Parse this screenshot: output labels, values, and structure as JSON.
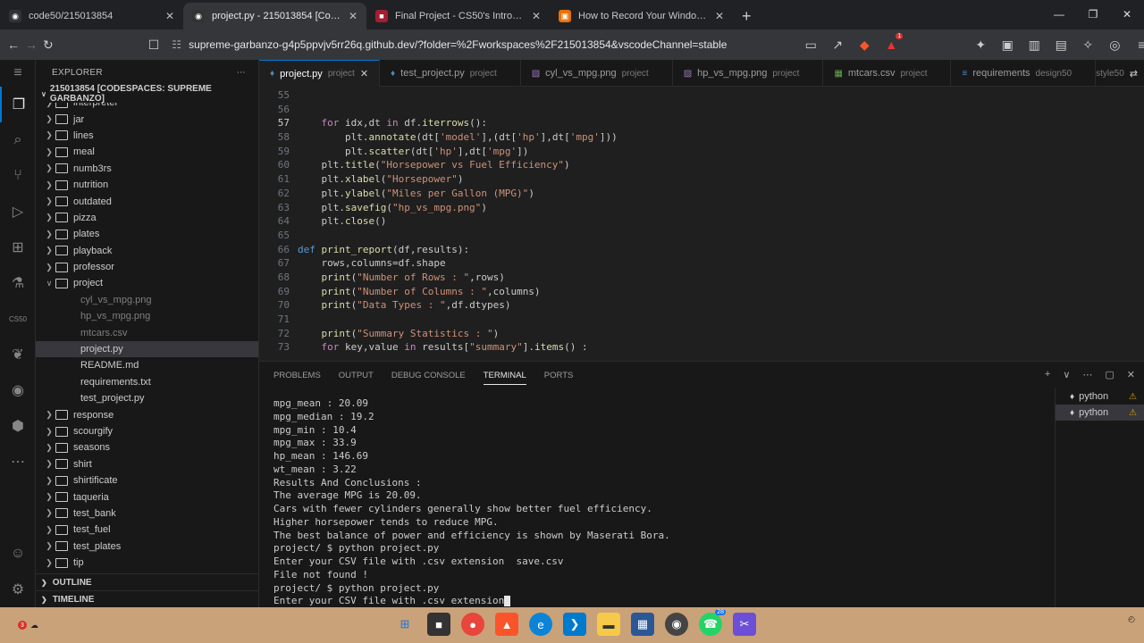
{
  "browser": {
    "tabs": [
      {
        "label": "code50/215013854",
        "icon": "github-icon",
        "active": false
      },
      {
        "label": "project.py - 215013854 [Codespaces",
        "icon": "github-icon",
        "active": true
      },
      {
        "label": "Final Project - CS50's Introduction to",
        "icon": "harvard-icon",
        "active": false
      },
      {
        "label": "How to Record Your Windows, Mac, L",
        "icon": "article-icon",
        "active": false
      }
    ],
    "url": "supreme-garbanzo-g4p5ppvjv5rr26q.github.dev/?folder=%2Fworkspaces%2F215013854&vscodeChannel=stable",
    "badge_count": "1"
  },
  "explorer": {
    "title": "EXPLORER",
    "root": "215013854 [CODESPACES: SUPREME GARBANZO]",
    "items": [
      {
        "label": "interpreter",
        "type": "folder",
        "depth": 0
      },
      {
        "label": "jar",
        "type": "folder",
        "depth": 0
      },
      {
        "label": "lines",
        "type": "folder",
        "depth": 0
      },
      {
        "label": "meal",
        "type": "folder",
        "depth": 0
      },
      {
        "label": "numb3rs",
        "type": "folder",
        "depth": 0
      },
      {
        "label": "nutrition",
        "type": "folder",
        "depth": 0
      },
      {
        "label": "outdated",
        "type": "folder",
        "depth": 0
      },
      {
        "label": "pizza",
        "type": "folder",
        "depth": 0
      },
      {
        "label": "plates",
        "type": "folder",
        "depth": 0
      },
      {
        "label": "playback",
        "type": "folder",
        "depth": 0
      },
      {
        "label": "professor",
        "type": "folder",
        "depth": 0
      },
      {
        "label": "project",
        "type": "folder-open",
        "depth": 0
      },
      {
        "label": "cyl_vs_mpg.png",
        "type": "file-dim",
        "depth": 1
      },
      {
        "label": "hp_vs_mpg.png",
        "type": "file-dim",
        "depth": 1
      },
      {
        "label": "mtcars.csv",
        "type": "file-dim",
        "depth": 1
      },
      {
        "label": "project.py",
        "type": "file-selected",
        "depth": 1
      },
      {
        "label": "README.md",
        "type": "file",
        "depth": 1
      },
      {
        "label": "requirements.txt",
        "type": "file",
        "depth": 1
      },
      {
        "label": "test_project.py",
        "type": "file",
        "depth": 1
      },
      {
        "label": "response",
        "type": "folder",
        "depth": 0
      },
      {
        "label": "scourgify",
        "type": "folder",
        "depth": 0
      },
      {
        "label": "seasons",
        "type": "folder",
        "depth": 0
      },
      {
        "label": "shirt",
        "type": "folder",
        "depth": 0
      },
      {
        "label": "shirtificate",
        "type": "folder",
        "depth": 0
      },
      {
        "label": "taqueria",
        "type": "folder",
        "depth": 0
      },
      {
        "label": "test_bank",
        "type": "folder",
        "depth": 0
      },
      {
        "label": "test_fuel",
        "type": "folder",
        "depth": 0
      },
      {
        "label": "test_plates",
        "type": "folder",
        "depth": 0
      },
      {
        "label": "tip",
        "type": "folder",
        "depth": 0
      }
    ],
    "outline": "OUTLINE",
    "timeline": "TIMELINE"
  },
  "editor_tabs": [
    {
      "name": "project.py",
      "desc": "project",
      "icon": "python-file-icon",
      "active": true
    },
    {
      "name": "test_project.py",
      "desc": "project",
      "icon": "python-file-icon",
      "active": false
    },
    {
      "name": "cyl_vs_mpg.png",
      "desc": "project",
      "icon": "image-file-icon",
      "active": false
    },
    {
      "name": "hp_vs_mpg.png",
      "desc": "project",
      "icon": "image-file-icon",
      "active": false
    },
    {
      "name": "mtcars.csv",
      "desc": "project",
      "icon": "csv-file-icon",
      "active": false
    },
    {
      "name": "requirements",
      "desc": "design50",
      "icon": "text-file-icon",
      "active": false
    }
  ],
  "editor_extra": "style50",
  "code_lines": [
    {
      "n": "55",
      "t": ""
    },
    {
      "n": "56",
      "t": ""
    },
    {
      "n": "57",
      "t": "    for idx,dt in df.iterrows():"
    },
    {
      "n": "58",
      "t": "        plt.annotate(dt['model'],(dt['hp'],dt['mpg']))"
    },
    {
      "n": "59",
      "t": "        plt.scatter(dt['hp'],dt['mpg'])"
    },
    {
      "n": "60",
      "t": "    plt.title(\"Horsepower vs Fuel Efficiency\")"
    },
    {
      "n": "61",
      "t": "    plt.xlabel(\"Horsepower\")"
    },
    {
      "n": "62",
      "t": "    plt.ylabel(\"Miles per Gallon (MPG)\")"
    },
    {
      "n": "63",
      "t": "    plt.savefig(\"hp_vs_mpg.png\")"
    },
    {
      "n": "64",
      "t": "    plt.close()"
    },
    {
      "n": "65",
      "t": ""
    },
    {
      "n": "66",
      "t": "def print_report(df,results):"
    },
    {
      "n": "67",
      "t": "    rows,columns=df.shape"
    },
    {
      "n": "68",
      "t": "    print(\"Number of Rows : \",rows)"
    },
    {
      "n": "69",
      "t": "    print(\"Number of Columns : \",columns)"
    },
    {
      "n": "70",
      "t": "    print(\"Data Types : \",df.dtypes)"
    },
    {
      "n": "71",
      "t": ""
    },
    {
      "n": "72",
      "t": "    print(\"Summary Statistics : \")"
    },
    {
      "n": "73",
      "t": "    for key,value in results[\"summary\"].items() :"
    }
  ],
  "panel": {
    "tabs": [
      "PROBLEMS",
      "OUTPUT",
      "DEBUG CONSOLE",
      "TERMINAL",
      "PORTS"
    ],
    "active_tab": "TERMINAL",
    "terminal_lines": [
      "mpg_mean : 20.09",
      "mpg_median : 19.2",
      "mpg_min : 10.4",
      "mpg_max : 33.9",
      "hp_mean : 146.69",
      "wt_mean : 3.22",
      "Results And Conclusions :",
      "The average MPG is 20.09.",
      "Cars with fewer cylinders generally show better fuel efficiency.",
      "Higher horsepower tends to reduce MPG.",
      "The best balance of power and efficiency is shown by Maserati Bora.",
      "project/ $ python project.py",
      "Enter your CSV file with .csv extension  save.csv",
      "File not found !",
      "project/ $ python project.py",
      "Enter your CSV file with .csv extension"
    ],
    "terminals": [
      "python",
      "python"
    ]
  },
  "taskbar": {
    "notif": "3",
    "badge": "28"
  }
}
